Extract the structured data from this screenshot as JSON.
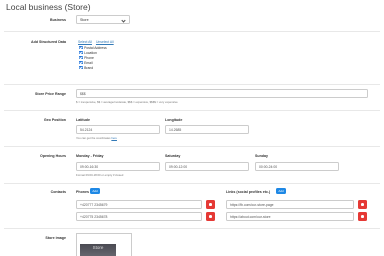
{
  "page": {
    "title": "Local business (Store)"
  },
  "business": {
    "label": "Business",
    "selected": "Store"
  },
  "structured": {
    "label": "Add Structured Data",
    "select_all": "Select All",
    "unselect_all": "Unselect All",
    "options": [
      "Postal Address",
      "Location",
      "Phone",
      "Email",
      "Brand"
    ],
    "checked": [
      true,
      true,
      true,
      true,
      true
    ]
  },
  "price": {
    "label": "Store Price Range",
    "value": "$$$",
    "help": "$ = inexpensive, $$ = average/moderate, $$$ = expensive, $$$$ = very expensive"
  },
  "geo": {
    "label": "Geo Position",
    "latitude_label": "Latitude",
    "latitude_value": "54.2124",
    "longitude_label": "Longitude",
    "longitude_value": "14.2685",
    "help_prefix": "You can get the coordinates ",
    "help_link": "here"
  },
  "hours": {
    "label": "Opening Hours",
    "weekdays_label": "Monday - Friday",
    "weekdays_value": "09:00-16:30",
    "saturday_label": "Saturday",
    "saturday_value": "09:00-12:00",
    "sunday_label": "Sunday",
    "sunday_value": "00:00-24:00",
    "help": "Format 09:00-18:00 or empty if closed"
  },
  "contacts": {
    "label": "Contacts",
    "phones_label": "Phones",
    "add_label": "Add",
    "phones": [
      "+420777 2345679",
      "+420775 2345678"
    ],
    "links_label": "Links (social profiles etc.)",
    "links": [
      "https://fb.com/our-store-page",
      "https://about.com/our-store"
    ]
  },
  "image": {
    "label": "Store image",
    "thumb_text": "Store"
  }
}
